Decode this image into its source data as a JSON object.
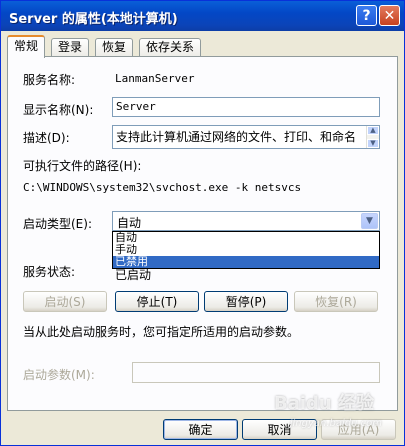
{
  "window": {
    "title": "Server 的属性(本地计算机)",
    "help_glyph": "?",
    "close_glyph": "✕"
  },
  "tabs": [
    {
      "label": "常规",
      "active": true
    },
    {
      "label": "登录",
      "active": false
    },
    {
      "label": "恢复",
      "active": false
    },
    {
      "label": "依存关系",
      "active": false
    }
  ],
  "general": {
    "service_name_label": "服务名称:",
    "service_name_value": "LanmanServer",
    "display_name_label": "显示名称(N):",
    "display_name_value": "Server",
    "description_label": "描述(D):",
    "description_value": "支持此计算机通过网络的文件、打印、和命名",
    "exe_path_label": "可执行文件的路径(H):",
    "exe_path_value": "C:\\WINDOWS\\system32\\svchost.exe -k netsvcs",
    "startup_type_label": "启动类型(E):",
    "startup_type_value": "自动",
    "startup_options": [
      "自动",
      "手动",
      "已禁用"
    ],
    "highlighted_option": "已禁用",
    "service_status_label": "服务状态:",
    "service_status_value": "已启动",
    "buttons": {
      "start": "启动(S)",
      "stop": "停止(T)",
      "pause": "暂停(P)",
      "resume": "恢复(R)"
    },
    "hint_text": "当从此处启动服务时，您可指定所适用的启动参数。",
    "start_params_label": "启动参数(M):"
  },
  "footer": {
    "ok": "确定",
    "cancel": "取消",
    "apply": "应用(A)"
  },
  "watermark": {
    "brand": "Baidu 经验",
    "url": "jingyan.baidu.com"
  },
  "colors": {
    "title_bar": "#0347c6",
    "selection": "#316ac5"
  }
}
